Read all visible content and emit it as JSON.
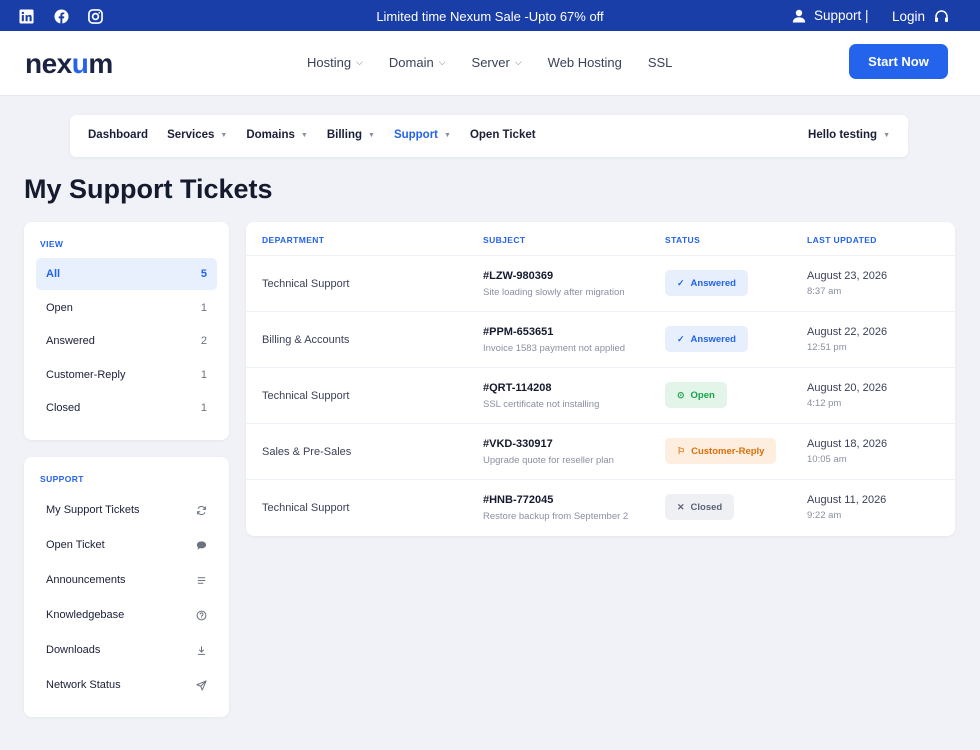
{
  "topbar": {
    "promo": "Limited time Nexum Sale -Upto 67% off",
    "support": "Support  |",
    "login": "Login",
    "social_icons": [
      "linkedin-icon",
      "facebook-icon",
      "instagram-icon"
    ]
  },
  "header": {
    "logo_pre": "nex",
    "logo_x": "u",
    "logo_post": "m",
    "nav": [
      {
        "label": "Hosting",
        "dropdown": true
      },
      {
        "label": "Domain",
        "dropdown": true
      },
      {
        "label": "Server",
        "dropdown": true
      },
      {
        "label": "Web Hosting",
        "dropdown": false
      },
      {
        "label": "SSL",
        "dropdown": false
      }
    ],
    "cta": "Start Now"
  },
  "subnav": {
    "items": [
      {
        "label": "Dashboard"
      },
      {
        "label": "Services"
      },
      {
        "label": "Domains"
      },
      {
        "label": "Billing"
      },
      {
        "label": "Support"
      },
      {
        "label": "Open Ticket"
      }
    ],
    "user": "Hello testing"
  },
  "page": {
    "title": "My Support Tickets"
  },
  "view_panel": {
    "heading": "VIEW",
    "items": [
      {
        "label": "All",
        "count": "5"
      },
      {
        "label": "Open",
        "count": "1"
      },
      {
        "label": "Answered",
        "count": "2"
      },
      {
        "label": "Customer-Reply",
        "count": "1"
      },
      {
        "label": "Closed",
        "count": "1"
      }
    ]
  },
  "support_panel": {
    "heading": "SUPPORT",
    "items": [
      {
        "label": "My Support Tickets",
        "icon": "refresh-icon"
      },
      {
        "label": "Open Ticket",
        "icon": "chat-bubble-icon"
      },
      {
        "label": "Announcements",
        "icon": "list-icon"
      },
      {
        "label": "Knowledgebase",
        "icon": "help-circle-icon"
      },
      {
        "label": "Downloads",
        "icon": "download-icon"
      },
      {
        "label": "Network Status",
        "icon": "send-icon"
      }
    ]
  },
  "tickets": {
    "columns": [
      "DEPARTMENT",
      "SUBJECT",
      "STATUS",
      "LAST UPDATED"
    ],
    "rows": [
      {
        "department": "Technical Support",
        "id": "#LZW-980369",
        "subject": "Site loading slowly after migration",
        "status": "Answered",
        "date": "August 23, 2026",
        "time": "8:37 am"
      },
      {
        "department": "Billing & Accounts",
        "id": "#PPM-653651",
        "subject": "Invoice 1583 payment not applied",
        "status": "Answered",
        "date": "August 22, 2026",
        "time": "12:51 pm"
      },
      {
        "department": "Technical Support",
        "id": "#QRT-114208",
        "subject": "SSL certificate not installing",
        "status": "Open",
        "date": "August 20, 2026",
        "time": "4:12 pm"
      },
      {
        "department": "Sales & Pre-Sales",
        "id": "#VKD-330917",
        "subject": "Upgrade quote for reseller plan",
        "status": "Customer-Reply",
        "date": "August 18, 2026",
        "time": "10:05 am"
      },
      {
        "department": "Technical Support",
        "id": "#HNB-772045",
        "subject": "Restore backup from September 2",
        "status": "Closed",
        "date": "August 11, 2026",
        "time": "9:22 am"
      }
    ]
  },
  "colors": {
    "brand": "#1a3ea8",
    "accent": "#2463eb",
    "answered_bg": "#e7effc",
    "answered_fg": "#2463eb",
    "open_bg": "#e3f5e9",
    "open_fg": "#16a34a",
    "reply_bg": "#fdeee0",
    "reply_fg": "#d9700a",
    "closed_bg": "#eef0f4",
    "closed_fg": "#5b6275"
  }
}
